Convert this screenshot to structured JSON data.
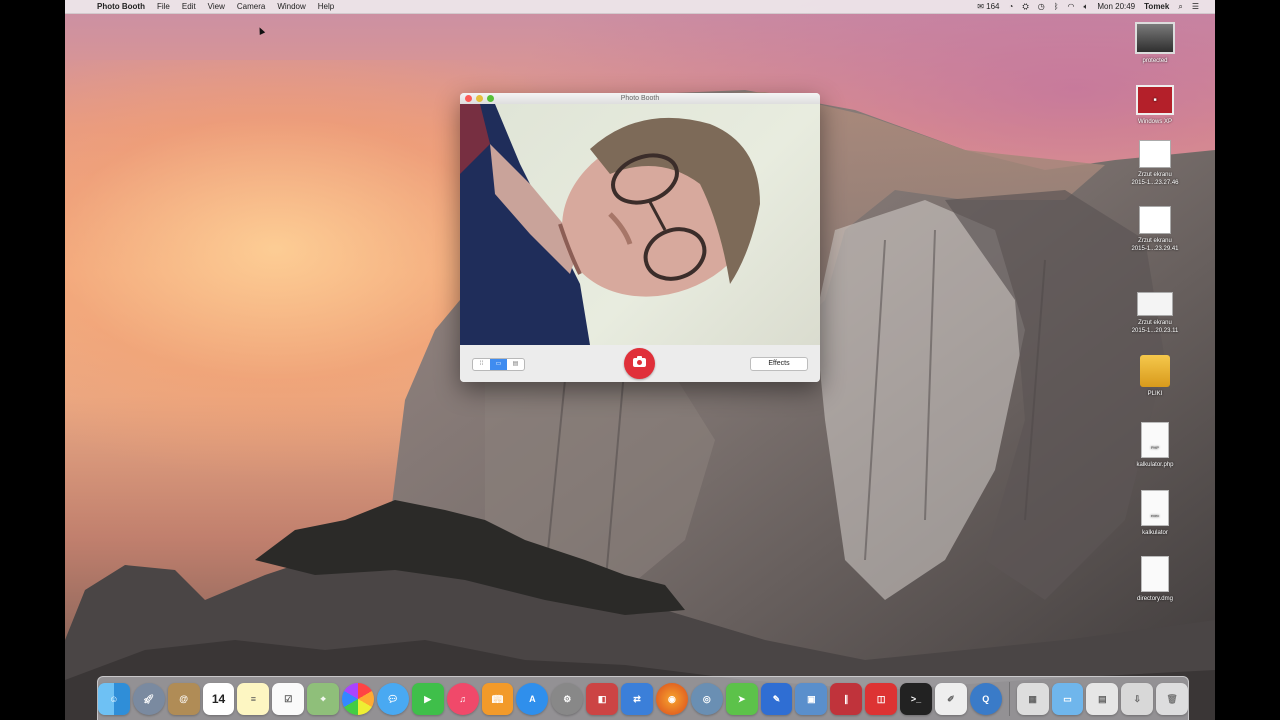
{
  "menubar": {
    "apple": "",
    "app_name": "Photo Booth",
    "menus": [
      "File",
      "Edit",
      "View",
      "Camera",
      "Window",
      "Help"
    ],
    "mail_count": "164",
    "clock": "Mon 20:49",
    "user": "Tomek"
  },
  "window": {
    "title": "Photo Booth",
    "effects_label": "Effects",
    "view_modes": [
      "4-up",
      "single",
      "strip"
    ],
    "active_view": "single"
  },
  "desktop_icons": [
    {
      "name": "protected",
      "icon": "screenshot-thumbnail"
    },
    {
      "name": "Windows XP",
      "icon": "vm-icon"
    },
    {
      "name_line1": "Zrzut ekranu",
      "name_line2": "2015-1...23.27.46",
      "icon": "screenshot-file"
    },
    {
      "name_line1": "Zrzut ekranu",
      "name_line2": "2015-1...23.29.41",
      "icon": "screenshot-file"
    },
    {
      "name_line1": "Zrzut ekranu",
      "name_line2": "2015-1...20.23.11",
      "icon": "screenshot-file"
    },
    {
      "name": "PLIKI",
      "icon": "drive-icon"
    },
    {
      "name": "kalkulator.php",
      "icon": "php-file-icon",
      "badge": "PHP"
    },
    {
      "name": "kalkulator",
      "icon": "exec-file-icon",
      "badge": "exec"
    },
    {
      "name": "directory.dmg",
      "icon": "dmg-file-icon"
    }
  ],
  "calendar_day": "14",
  "colors": {
    "shutter": "#e0303a",
    "active_seg": "#3f8cf0",
    "menubar": "#eee8ec"
  }
}
